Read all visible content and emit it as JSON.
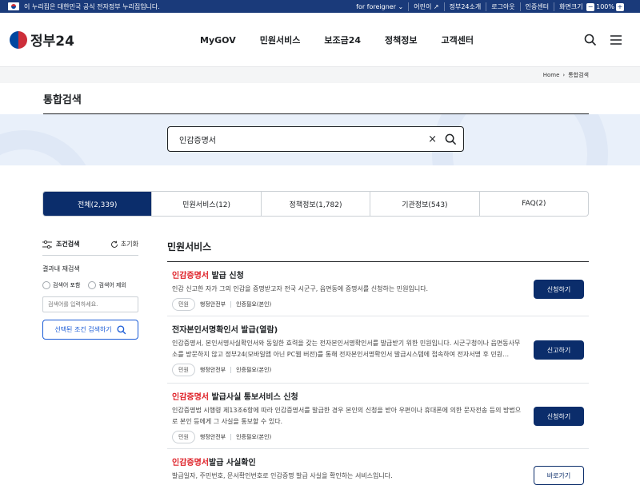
{
  "topbar": {
    "notice": "이 누리집은 대한민국 공식 전자정부 누리집입니다.",
    "links": [
      "for foreigner",
      "어린이",
      "정부24소개",
      "로그아웃",
      "인증센터"
    ],
    "zoom_label": "화면크기",
    "zoom_value": "100%",
    "zoom_minus": "−",
    "zoom_plus": "+"
  },
  "header": {
    "logo_text": "정부24",
    "nav": [
      "MyGOV",
      "민원서비스",
      "보조금24",
      "정책정보",
      "고객센터"
    ]
  },
  "breadcrumb": {
    "home": "Home",
    "sep": "›",
    "current": "통합검색"
  },
  "page_title": "통합검색",
  "search": {
    "value": "인감증명서",
    "clear": "×"
  },
  "tabs": [
    {
      "label": "전체(2,339)",
      "active": true
    },
    {
      "label": "민원서비스(12)",
      "active": false
    },
    {
      "label": "정책정보(1,782)",
      "active": false
    },
    {
      "label": "기관정보(543)",
      "active": false
    },
    {
      "label": "FAQ(2)",
      "active": false
    }
  ],
  "sidebar": {
    "title": "조건검색",
    "reset": "초기화",
    "refine_label": "결과내 재검색",
    "include": "검색어 포함",
    "exclude": "검색어 제외",
    "input_placeholder": "검색어를 입력하세요.",
    "search_button": "선택된 조건 검색하기"
  },
  "results": {
    "section_title": "민원서비스",
    "items": [
      {
        "title_highlight": "인감증명서",
        "title_rest": " 발급 신청",
        "desc": "인감 신고한 자가 그의 인감을 증명받고자 전국 시군구, 읍면동에 증명서를 신청하는 민원입니다.",
        "chip": "민원",
        "org": "행정안전부",
        "auth": "인증필요(본인)",
        "action": "신청하기"
      },
      {
        "title_highlight": "",
        "title_rest": "전자본인서명확인서 발급(열람)",
        "desc": "인감증명서, 본인서명사실확인서와 동일한 효력을 갖는 전자본인서명확인서를 발급받기 위한 민원입니다. 시군구청이나 읍면동사무소를 방문하지 않고 정부24(모바일앱 아닌 PC웹 버전)를 통해 전자본인서명확인서 발급시스템에 접속하여 전자서명 후 민원…",
        "chip": "민원",
        "org": "행정안전부",
        "auth": "인증필요(본인)",
        "action": "신고하기"
      },
      {
        "title_highlight": "인감증명서",
        "title_rest": " 발급사실 통보서비스 신청",
        "desc": "인감증명법 시행령 제13조6항에 따라 인감증명서를 발급한 경우 본인의 신청을 받아 우편이나 휴대폰에 의한 문자전송 등의 방법으로 본인 등에게 그 사실을 통보할 수 있다.",
        "chip": "민원",
        "org": "행정안전부",
        "auth": "인증필요(본인)",
        "action": "신청하기"
      },
      {
        "title_highlight": "인감증명서",
        "title_rest": "발급 사실확인",
        "desc": "발급일자, 주민번호, 문서확인번호로 인감증명 발급 사실을 확인하는 서비스입니다.",
        "chip": "",
        "org": "",
        "auth": "",
        "action": "바로가기"
      }
    ]
  },
  "colors": {
    "topbar": "#1a3a7a",
    "primary": "#0b2d6b",
    "highlight": "#de1f26",
    "band": "#e9f0fa"
  }
}
